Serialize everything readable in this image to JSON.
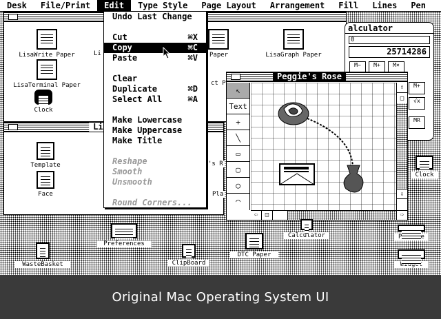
{
  "menubar": {
    "items": [
      {
        "label": "Desk"
      },
      {
        "label": "File/Print"
      },
      {
        "label": "Edit"
      },
      {
        "label": "Type Style"
      },
      {
        "label": "Page Layout"
      },
      {
        "label": "Arrangement"
      },
      {
        "label": "Fill"
      },
      {
        "label": "Lines"
      },
      {
        "label": "Pen"
      }
    ]
  },
  "edit_menu": {
    "undo": "Undo Last Change",
    "cut": "Cut",
    "cut_key": "⌘X",
    "copy": "Copy",
    "copy_key": "⌘C",
    "paste": "Paste",
    "paste_key": "⌘V",
    "clear": "Clear",
    "duplicate": "Duplicate",
    "duplicate_key": "⌘D",
    "select_all": "Select All",
    "select_all_key": "⌘A",
    "lowercase": "Make Lowercase",
    "uppercase": "Make Uppercase",
    "title": "Make Title",
    "reshape": "Reshape",
    "smooth": "Smooth",
    "unsmooth": "Unsmooth",
    "round_corners": "Round Corners..."
  },
  "desktop_window": {
    "icons": {
      "lisawrite": "LisaWrite Paper",
      "lisaterminal": "LisaTerminal Paper",
      "clock": "Clock",
      "lisagraph": "LisaGraph Paper",
      "li_partial": "Li",
      "paper_partial": "Paper",
      "ct_partial": "ct P"
    }
  },
  "lisadraw_window": {
    "title_partial": "Lis",
    "icons": {
      "template": "Template",
      "face": "Face",
      "rs_partial": "'s R",
      "pla_partial": "Pla"
    }
  },
  "calculator": {
    "title": "alculator",
    "memory": "0",
    "display": "25714286",
    "keys": {
      "m_minus": "M−",
      "m_plus": "M+",
      "mx": "M×",
      "m_plus_side": "M+",
      "sqrt": "√x",
      "mr": "MR"
    }
  },
  "drawing_window": {
    "title": "Peggie's Rose",
    "tool_text": "Text"
  },
  "desk_icons": {
    "calculator": "Calculator",
    "profile": "Profile",
    "clock": "Clock",
    "preferences": "Preferences",
    "dtc": "DTC Paper",
    "wastebasket": "WasteBasket",
    "clipboard": "ClipBoard",
    "widget": "Widget"
  },
  "caption": "Original Mac Operating System UI"
}
